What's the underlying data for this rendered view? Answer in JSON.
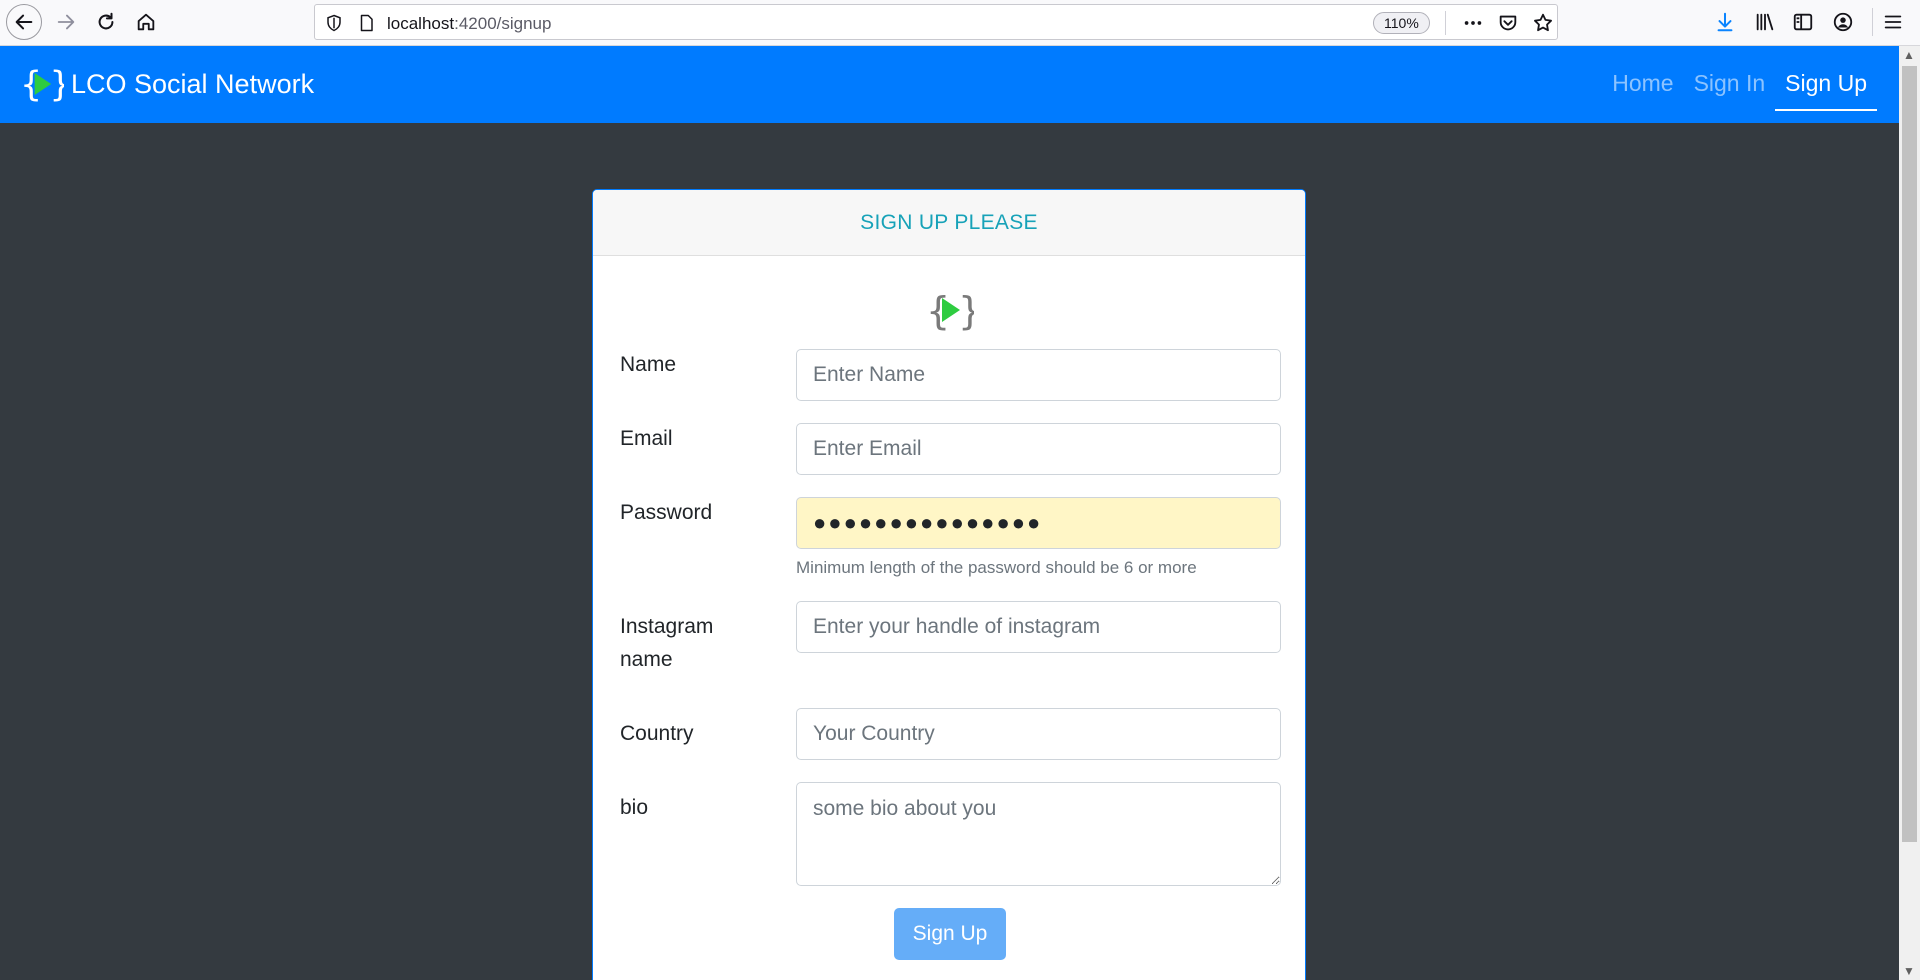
{
  "browser": {
    "url_host": "localhost",
    "url_path": ":4200/signup",
    "zoom": "110%"
  },
  "navbar": {
    "brand_name": "LCO Social Network",
    "links": [
      {
        "label": "Home",
        "active": false
      },
      {
        "label": "Sign In",
        "active": false
      },
      {
        "label": "Sign Up",
        "active": true
      }
    ]
  },
  "card": {
    "title": "SIGN UP PLEASE"
  },
  "form": {
    "name": {
      "label": "Name",
      "placeholder": "Enter Name",
      "value": ""
    },
    "email": {
      "label": "Email",
      "placeholder": "Enter Email",
      "value": ""
    },
    "password": {
      "label": "Password",
      "value": "●●●●●●●●●●●●●●●",
      "help": "Minimum length of the password should be 6 or more"
    },
    "instagram": {
      "label_line1": "Instagram",
      "label_line2": "name",
      "placeholder": "Enter your handle of instagram",
      "value": ""
    },
    "country": {
      "label": "Country",
      "placeholder": "Your Country",
      "value": ""
    },
    "bio": {
      "label": "bio",
      "placeholder": "some bio about you",
      "value": ""
    },
    "submit_label": "Sign Up"
  },
  "colors": {
    "navbar_bg": "#007bff",
    "page_bg": "#343a40",
    "card_title": "#17a2b8",
    "logo_play": "#2ecc40",
    "autofill_bg": "#fff6c6",
    "button_bg": "#65adf8"
  },
  "icons": {
    "back": "arrow-left-icon",
    "forward": "arrow-right-icon",
    "reload": "reload-icon",
    "home": "home-icon",
    "shield": "shield-icon",
    "page": "page-icon",
    "more": "more-dots-icon",
    "pocket": "pocket-icon",
    "bookmark": "star-icon",
    "download": "download-icon",
    "library": "library-icon",
    "sidebar": "sidebar-icon",
    "account": "account-icon",
    "menu": "hamburger-menu-icon",
    "logo": "lco-logo-icon"
  }
}
